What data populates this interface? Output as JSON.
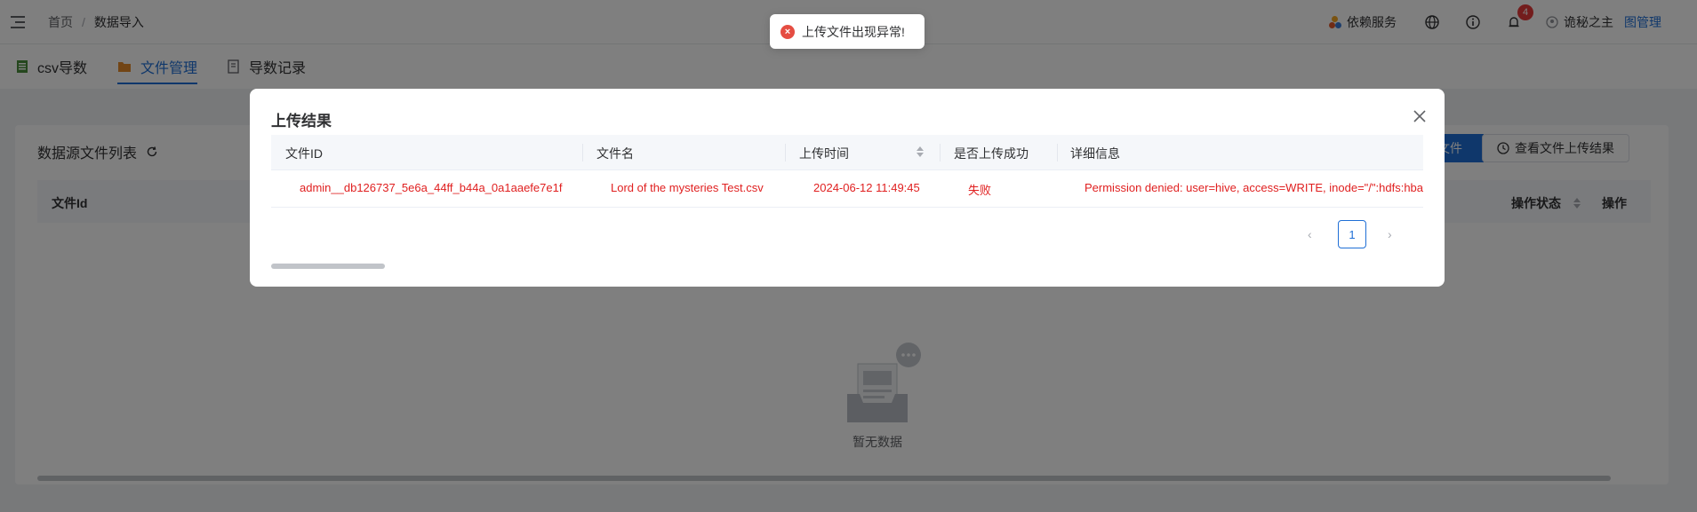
{
  "topbar": {
    "breadcrumb": [
      "首页",
      "数据导入"
    ],
    "breadcrumb_sep": "/",
    "dependency_service": "依赖服务",
    "notification_count": "4",
    "user_name": "诡秘之主",
    "user_role": "图管理"
  },
  "tabs": [
    {
      "label": "csv导数",
      "icon": "csv-file-icon",
      "active": false
    },
    {
      "label": "文件管理",
      "icon": "folder-icon",
      "active": true
    },
    {
      "label": "导数记录",
      "icon": "record-icon",
      "active": false
    }
  ],
  "panel": {
    "title": "数据源文件列表",
    "upload_button": "文件",
    "result_button": "查看文件上传结果",
    "columns": {
      "file_id": "文件Id",
      "status": "操作状态",
      "action": "操作"
    },
    "empty_text": "暂无数据"
  },
  "toast": {
    "message": "上传文件出现异常!"
  },
  "modal": {
    "title": "上传结果",
    "columns": [
      "文件ID",
      "文件名",
      "上传时间",
      "是否上传成功",
      "详细信息"
    ],
    "rows": [
      {
        "file_id": "admin__db126737_5e6a_44ff_b44a_0a1aaefe7e1f",
        "file_name": "Lord of the mysteries Test.csv",
        "upload_time": "2024-06-12 11:49:45",
        "success": "失败",
        "detail": "Permission denied: user=hive, access=WRITE, inode=\"/\":hdfs:hba"
      }
    ],
    "pagination": {
      "current_page": "1"
    }
  },
  "colors": {
    "primary": "#1f6fd6",
    "error": "#e02020",
    "overlay": "rgba(0,0,0,0.5)"
  }
}
